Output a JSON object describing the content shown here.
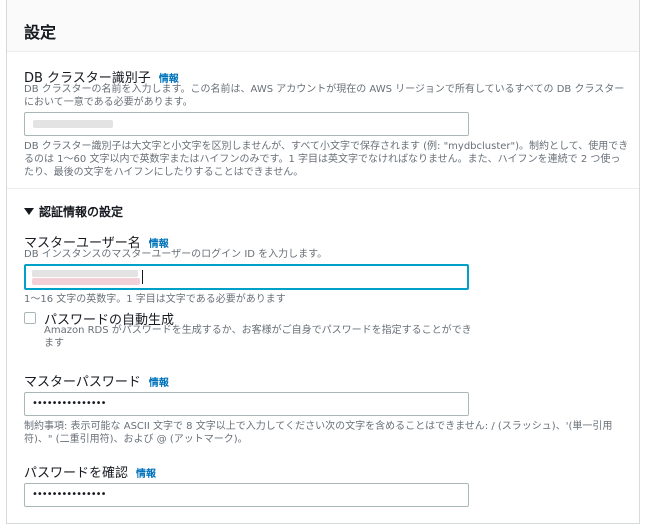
{
  "panel": {
    "title": "設定"
  },
  "cluster_id": {
    "label": "DB クラスター識別子",
    "info": "情報",
    "desc_lines": [
      "DB クラスターの名前を入力します。この名前は、AWS アカウントが現在の AWS リージョンで所有しているすべての DB クラスター",
      "において一意である必要があります。"
    ],
    "hint_lines": [
      "DB クラスター識別子は大文字と小文字を区別しませんが、すべて小文字で保存されます (例: \"mydbcluster\")。制約として、使用でき",
      "るのは 1〜60 文字以内で英数字またはハイフンのみです。1 字目は英文字でなければなりません。また、ハイフンを連続で 2 つ使っ",
      "たり、最後の文字をハイフンにしたりすることはできません。"
    ]
  },
  "credentials": {
    "section_title": "認証情報の設定"
  },
  "master_user": {
    "label": "マスターユーザー名",
    "info": "情報",
    "desc": "DB インスタンスのマスターユーザーのログイン ID を入力します。",
    "hint": "1〜16 文字の英数字。1 字目は文字である必要があります"
  },
  "auto_password": {
    "label": "パスワードの自動生成",
    "desc_lines": [
      "Amazon RDS がパスワードを生成するか、お客様がご自身でパスワードを指定することができ",
      "ます"
    ]
  },
  "master_password": {
    "label": "マスターパスワード",
    "info": "情報",
    "value": "•••••••••••••••",
    "hint_lines": [
      "制約事項: 表示可能な ASCII 文字で 8 文字以上で入力してください次の文字を含めることはできません: / (スラッシュ)、'(単一引用",
      "符)、\" (二重引用符)、および @ (アットマーク)。"
    ]
  },
  "confirm_password": {
    "label": "パスワードを確認",
    "info": "情報",
    "value": "•••••••••••••••"
  },
  "colors": {
    "accent": "#00a1c9",
    "link": "#0073bb",
    "muted": "#687078"
  }
}
